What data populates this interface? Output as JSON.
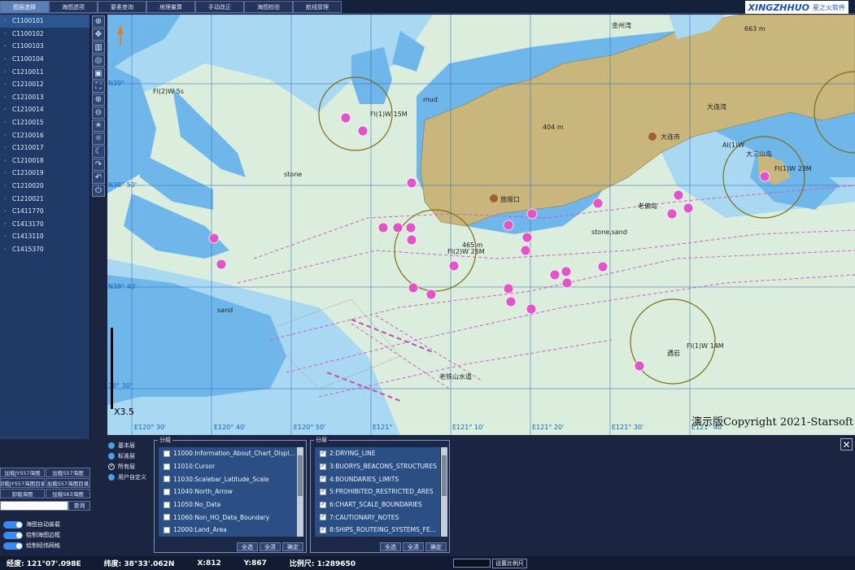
{
  "tabs": [
    "图层选择",
    "海图选项",
    "要素查询",
    "地理量算",
    "手动改正",
    "海图校验",
    "航线管理"
  ],
  "brand": {
    "logo": "XINGZHHUO",
    "name": "星之火软件"
  },
  "charts": [
    "C1100101",
    "C1100102",
    "C1100103",
    "C1100104",
    "C1210011",
    "C1210012",
    "C1210013",
    "C1210014",
    "C1210015",
    "C1210016",
    "C1210017",
    "C1210018",
    "C1210019",
    "C1210020",
    "C1210021",
    "C1411770",
    "C1413170",
    "C1413110",
    "C1415370"
  ],
  "toolbar_icons": [
    "zoom-in-icon",
    "pan-icon",
    "ruler-icon",
    "target-icon",
    "display-icon",
    "fit-icon",
    "zoom-in-magnify-icon",
    "zoom-out-magnify-icon",
    "sun-icon",
    "sun-dim-icon",
    "moon-icon",
    "redo-icon",
    "undo-icon",
    "power-icon"
  ],
  "load_buttons": [
    [
      "加载JYS57海图",
      "加载S57海图"
    ],
    [
      "卸载JYS57海图目录",
      "加载S57海图目录"
    ],
    [
      "卸载海图",
      "加载S63海图"
    ]
  ],
  "query_label": "查询",
  "toggles": [
    "海图自动装载",
    "绘制海图边框",
    "绘制经纬网格"
  ],
  "layer_radios": [
    {
      "label": "基本层",
      "type": "dot"
    },
    {
      "label": "标准层",
      "type": "dot"
    },
    {
      "label": "所有层",
      "type": "x"
    },
    {
      "label": "用户自定义",
      "type": "dot"
    }
  ],
  "group_box": {
    "title": "分组",
    "items": [
      "11000:Information_About_Chart_Displ...",
      "11010:Cursor",
      "11030:Scalebar_Latitude_Scale",
      "11040:North_Arrow",
      "11050:No_Data",
      "11060:Non_HO_Data_Boundary",
      "12000:Land_Area"
    ],
    "buttons": [
      "全选",
      "全清",
      "确定"
    ]
  },
  "sublayer_box": {
    "title": "分层",
    "items": [
      "2:DRYING_LINE",
      "3:BUORYS_BEACONS_STRUCTURES",
      "4:BOUNDARIES_LIMITS",
      "5:PROHIBITED_RESTRICTED_ARES",
      "6:CHART_SCALE_BOUNDARIES",
      "7:CAUTIONARY_NOTES",
      "8:SHIPS_ROUTEING_SYSTEMS_FE..."
    ],
    "buttons": [
      "全选",
      "全清",
      "确定"
    ]
  },
  "map": {
    "places": [
      "金州湾",
      "大连湾",
      "大连市",
      "旅顺口",
      "老偏岛",
      "老铁山水道",
      "遇岩",
      "大三山岛"
    ],
    "lights": [
      "Fl(2)W 5s",
      "Fl(1)W 15M",
      "Fl(2)W 25M",
      "Fl(1)W 23M",
      "Fl(1)W 14M",
      "Al(1)W"
    ],
    "labels": [
      "mud",
      "sand",
      "stone",
      "stone,sand",
      "404 m",
      "465 m",
      "663 m"
    ],
    "lat_labels": [
      "N39°",
      "N38° 50'",
      "N38° 40'",
      "38° 30'"
    ],
    "lon_labels": [
      "E120° 30'",
      "E120° 40'",
      "E120° 50'",
      "E121°",
      "E121° 10'",
      "E121° 20'",
      "E121° 30'",
      "E121° 40'"
    ],
    "scale_label": "X3.5",
    "copyright": "演示版Copyright 2021-Starsoft"
  },
  "status": {
    "lon": "经度: 121°07'.098E",
    "lat": "纬度: 38°33'.062N",
    "x": "X:812",
    "y": "Y:867",
    "scale": "比例尺: 1:289650",
    "set_scale": "设置比例尺"
  },
  "colors": {
    "land": "#c9b67d",
    "shallow": "#6fb6ea",
    "medium": "#a9d8f2",
    "deep": "#dbeede",
    "route": "#d05ac4",
    "danger": "#e155c8",
    "circle": "#7c6d12"
  }
}
